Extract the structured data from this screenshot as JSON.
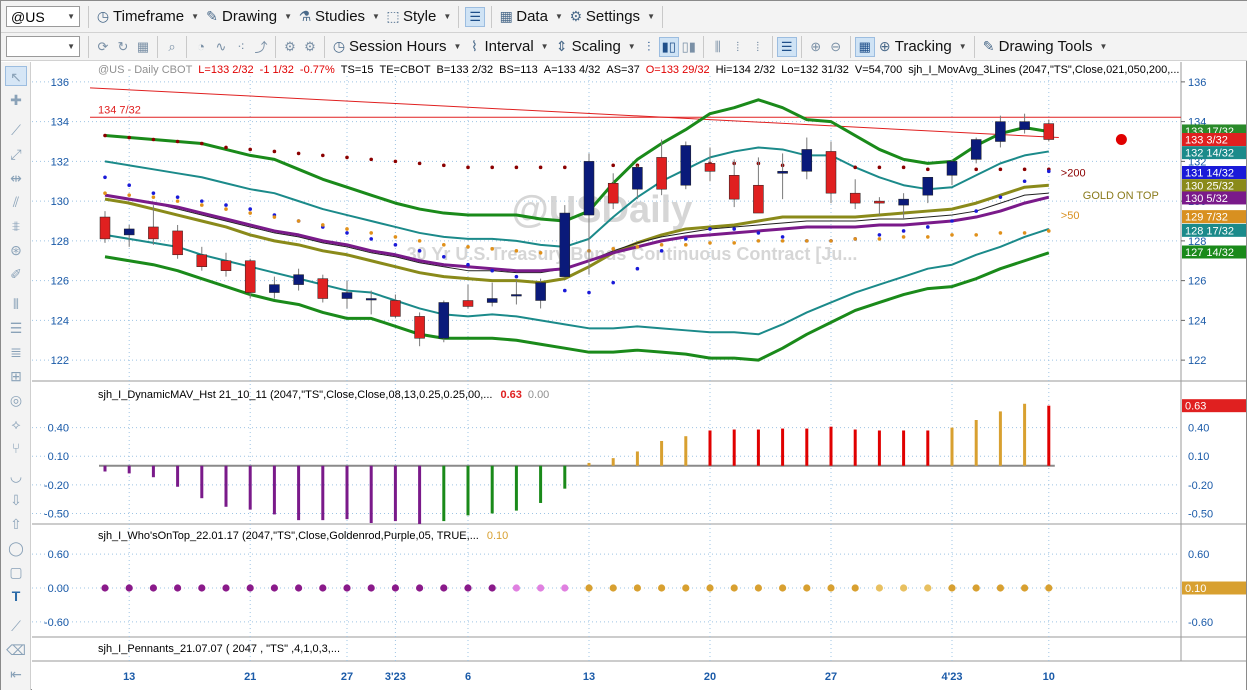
{
  "toolbar": {
    "symbol": "@US",
    "timeframe": "Timeframe",
    "drawing": "Drawing",
    "studies": "Studies",
    "style": "Style",
    "data": "Data",
    "settings": "Settings",
    "session_hours": "Session Hours",
    "interval": "Interval",
    "scaling": "Scaling",
    "tracking": "Tracking",
    "drawing_tools": "Drawing Tools"
  },
  "chart_data": {
    "type": "candlestick",
    "header": "@US - Daily  CBOT",
    "status": [
      {
        "text": "L=133 2/32",
        "color": "#e00000"
      },
      {
        "text": "-1 1/32",
        "color": "#e00000"
      },
      {
        "text": "-0.77%",
        "color": "#e00000"
      },
      {
        "text": "TS=15",
        "color": "#000000"
      },
      {
        "text": "TE=CBOT",
        "color": "#000000"
      },
      {
        "text": "B=133 2/32",
        "color": "#000000"
      },
      {
        "text": "BS=113",
        "color": "#000000"
      },
      {
        "text": "A=133 4/32",
        "color": "#000000"
      },
      {
        "text": "AS=37",
        "color": "#000000"
      },
      {
        "text": "O=133 29/32",
        "color": "#e00000"
      },
      {
        "text": "Hi=134 2/32",
        "color": "#000000"
      },
      {
        "text": "Lo=132 31/32",
        "color": "#000000"
      },
      {
        "text": "V=54,700",
        "color": "#000000"
      },
      {
        "text": "sjh_I_MovAvg_3Lines (2047,\"TS\",Close,021,050,200,...",
        "color": "#000000"
      }
    ],
    "watermark": "@USDaily",
    "watermark_sub": "30 Yr U.S.Treasury Bonds Continuous Contract [Ju...",
    "ylim": [
      121,
      137
    ],
    "yticks": [
      122,
      124,
      126,
      128,
      130,
      132,
      134,
      136
    ],
    "xlabels": [
      {
        "i": 1,
        "label": "13"
      },
      {
        "i": 6,
        "label": "21"
      },
      {
        "i": 10,
        "label": "27"
      },
      {
        "i": 12,
        "label": "3'23"
      },
      {
        "i": 15,
        "label": "6"
      },
      {
        "i": 20,
        "label": "13"
      },
      {
        "i": 25,
        "label": "20"
      },
      {
        "i": 30,
        "label": "27"
      },
      {
        "i": 35,
        "label": "4'23"
      },
      {
        "i": 39,
        "label": "10"
      }
    ],
    "candles": [
      {
        "o": 129.2,
        "h": 129.5,
        "l": 127.9,
        "c": 128.1
      },
      {
        "o": 128.3,
        "h": 128.8,
        "l": 127.7,
        "c": 128.6
      },
      {
        "o": 128.7,
        "h": 129.8,
        "l": 127.8,
        "c": 128.1
      },
      {
        "o": 128.5,
        "h": 128.8,
        "l": 127.1,
        "c": 127.3
      },
      {
        "o": 127.3,
        "h": 127.7,
        "l": 126.5,
        "c": 126.7
      },
      {
        "o": 127.0,
        "h": 127.4,
        "l": 126.2,
        "c": 126.5
      },
      {
        "o": 127.0,
        "h": 127.1,
        "l": 125.1,
        "c": 125.4
      },
      {
        "o": 125.4,
        "h": 126.2,
        "l": 125.1,
        "c": 125.8
      },
      {
        "o": 125.8,
        "h": 126.6,
        "l": 125.5,
        "c": 126.3
      },
      {
        "o": 126.1,
        "h": 126.3,
        "l": 124.9,
        "c": 125.1
      },
      {
        "o": 125.1,
        "h": 126.0,
        "l": 124.6,
        "c": 125.4
      },
      {
        "o": 125.1,
        "h": 125.5,
        "l": 124.3,
        "c": 125.1
      },
      {
        "o": 125.0,
        "h": 125.3,
        "l": 124.1,
        "c": 124.2
      },
      {
        "o": 124.2,
        "h": 124.4,
        "l": 122.7,
        "c": 123.1
      },
      {
        "o": 123.1,
        "h": 125.0,
        "l": 122.9,
        "c": 124.9
      },
      {
        "o": 125.0,
        "h": 125.8,
        "l": 124.6,
        "c": 124.7
      },
      {
        "o": 124.9,
        "h": 125.9,
        "l": 124.7,
        "c": 125.1
      },
      {
        "o": 125.3,
        "h": 126.0,
        "l": 124.8,
        "c": 125.3
      },
      {
        "o": 125.0,
        "h": 126.1,
        "l": 124.6,
        "c": 125.9
      },
      {
        "o": 126.2,
        "h": 129.8,
        "l": 126.1,
        "c": 129.4
      },
      {
        "o": 129.3,
        "h": 132.4,
        "l": 126.3,
        "c": 132.0
      },
      {
        "o": 130.9,
        "h": 131.4,
        "l": 129.6,
        "c": 129.9
      },
      {
        "o": 130.6,
        "h": 131.8,
        "l": 130.1,
        "c": 131.7
      },
      {
        "o": 132.2,
        "h": 133.1,
        "l": 130.3,
        "c": 130.6
      },
      {
        "o": 130.8,
        "h": 133.0,
        "l": 130.6,
        "c": 132.8
      },
      {
        "o": 131.9,
        "h": 132.7,
        "l": 131.0,
        "c": 131.5
      },
      {
        "o": 131.3,
        "h": 132.1,
        "l": 129.7,
        "c": 130.1
      },
      {
        "o": 130.8,
        "h": 132.2,
        "l": 129.6,
        "c": 129.4
      },
      {
        "o": 131.4,
        "h": 132.4,
        "l": 130.1,
        "c": 131.5
      },
      {
        "o": 131.5,
        "h": 133.2,
        "l": 131.1,
        "c": 132.6
      },
      {
        "o": 132.5,
        "h": 133.0,
        "l": 129.9,
        "c": 130.4
      },
      {
        "o": 130.4,
        "h": 131.1,
        "l": 129.6,
        "c": 129.9
      },
      {
        "o": 130.0,
        "h": 130.2,
        "l": 129.3,
        "c": 129.9
      },
      {
        "o": 129.8,
        "h": 130.4,
        "l": 129.1,
        "c": 130.1
      },
      {
        "o": 130.3,
        "h": 131.2,
        "l": 129.9,
        "c": 131.2
      },
      {
        "o": 131.3,
        "h": 132.1,
        "l": 130.8,
        "c": 132.0
      },
      {
        "o": 132.1,
        "h": 133.2,
        "l": 131.9,
        "c": 133.1
      },
      {
        "o": 133.0,
        "h": 134.3,
        "l": 132.7,
        "c": 134.0
      },
      {
        "o": 133.6,
        "h": 134.4,
        "l": 133.4,
        "c": 134.0
      },
      {
        "o": 133.9,
        "h": 134.1,
        "l": 133.0,
        "c": 133.1
      }
    ],
    "bands": [
      {
        "name": "outer-green",
        "color": "#1a8a1a",
        "width": 3,
        "upper": [
          133.3,
          133.2,
          133.1,
          133.0,
          132.9,
          132.6,
          132.3,
          132.1,
          131.6,
          131.1,
          130.7,
          130.3,
          129.9,
          129.6,
          129.4,
          129.3,
          129.3,
          129.3,
          129.1,
          129.0,
          129.5,
          130.9,
          132.1,
          132.9,
          133.6,
          134.4,
          134.7,
          135.1,
          134.7,
          134.1,
          134.0,
          133.3,
          132.6,
          132.1,
          131.9,
          132.0,
          132.8,
          133.4,
          133.7,
          133.5
        ],
        "lower": [
          127.2,
          127.0,
          126.8,
          126.5,
          126.1,
          125.7,
          125.3,
          125.0,
          124.8,
          124.4,
          124.1,
          124.1,
          123.7,
          123.3,
          123.1,
          123.1,
          123.1,
          123.0,
          122.8,
          122.6,
          122.4,
          122.4,
          122.5,
          122.4,
          122.3,
          122.1,
          122.1,
          122.0,
          122.6,
          123.3,
          123.9,
          124.5,
          124.9,
          125.3,
          125.6,
          125.7,
          126.1,
          126.6,
          127.0,
          127.4
        ]
      },
      {
        "name": "inner-teal",
        "color": "#1b8a8a",
        "width": 2,
        "upper": [
          132.0,
          131.8,
          131.6,
          131.4,
          131.2,
          130.9,
          130.6,
          130.4,
          130.0,
          129.6,
          129.3,
          129.0,
          128.7,
          128.4,
          128.2,
          128.1,
          128.1,
          128.0,
          127.8,
          127.7,
          128.1,
          129.2,
          130.2,
          131.0,
          131.6,
          132.2,
          132.5,
          132.7,
          132.6,
          132.3,
          132.3,
          131.7,
          131.2,
          130.8,
          130.6,
          130.7,
          131.3,
          131.9,
          132.3,
          132.5
        ],
        "lower": [
          128.3,
          128.1,
          127.9,
          127.7,
          127.3,
          127.0,
          126.7,
          126.4,
          126.1,
          125.8,
          125.5,
          125.4,
          125.0,
          124.6,
          124.3,
          124.2,
          124.3,
          124.2,
          124.0,
          123.8,
          123.6,
          123.6,
          123.7,
          123.6,
          123.5,
          123.4,
          123.4,
          123.3,
          123.8,
          124.4,
          124.9,
          125.4,
          125.8,
          126.2,
          126.6,
          126.8,
          127.3,
          127.7,
          128.2,
          128.6
        ]
      }
    ],
    "ma_lines": [
      {
        "name": "ma-gold",
        "color": "#8a8a1a",
        "width": 3,
        "values": [
          130.1,
          129.9,
          129.6,
          129.3,
          129.0,
          128.7,
          128.3,
          128.0,
          127.8,
          127.5,
          127.3,
          127.0,
          126.7,
          126.4,
          126.2,
          126.1,
          126.0,
          126.0,
          125.9,
          126.1,
          126.7,
          127.4,
          127.9,
          128.3,
          128.6,
          128.7,
          128.8,
          129.0,
          129.2,
          129.2,
          129.2,
          129.2,
          129.3,
          129.4,
          129.5,
          129.6,
          129.9,
          130.3,
          130.7,
          130.8
        ]
      },
      {
        "name": "ma-black",
        "color": "#202020",
        "width": 1,
        "values": [
          130.3,
          130.1,
          129.9,
          129.6,
          129.3,
          129.0,
          128.7,
          128.4,
          128.2,
          127.9,
          127.7,
          127.4,
          127.2,
          126.9,
          126.7,
          126.5,
          126.5,
          126.4,
          126.4,
          126.6,
          127.0,
          127.5,
          127.9,
          128.2,
          128.4,
          128.6,
          128.7,
          128.8,
          128.9,
          129.0,
          129.0,
          129.0,
          129.1,
          129.1,
          129.2,
          129.3,
          129.5,
          129.9,
          130.3,
          130.4
        ]
      },
      {
        "name": "ma-purple",
        "color": "#7a1a8a",
        "width": 3,
        "values": [
          130.3,
          130.1,
          129.9,
          129.7,
          129.4,
          129.1,
          128.8,
          128.5,
          128.3,
          128.0,
          127.8,
          127.5,
          127.3,
          127.0,
          126.8,
          126.7,
          126.6,
          126.5,
          126.5,
          126.6,
          127.0,
          127.4,
          127.7,
          128.0,
          128.2,
          128.3,
          128.4,
          128.5,
          128.6,
          128.7,
          128.7,
          128.7,
          128.8,
          128.8,
          128.9,
          129.0,
          129.2,
          129.5,
          129.9,
          130.2
        ]
      }
    ],
    "dot_series": [
      {
        "name": "dots-darkred",
        "color": "#8b0000",
        "values": [
          133.3,
          133.2,
          133.1,
          133.0,
          132.9,
          132.7,
          132.6,
          132.5,
          132.4,
          132.3,
          132.2,
          132.1,
          132.0,
          131.9,
          131.8,
          131.7,
          131.7,
          131.7,
          131.7,
          131.7,
          131.8,
          131.8,
          131.8,
          131.9,
          131.9,
          131.9,
          131.9,
          131.9,
          131.8,
          131.8,
          131.8,
          131.7,
          131.7,
          131.7,
          131.6,
          131.6,
          131.6,
          131.6,
          131.6,
          131.6
        ]
      },
      {
        "name": "dots-blue",
        "color": "#1a1ad8",
        "values": [
          131.2,
          130.8,
          130.4,
          130.2,
          130.0,
          129.8,
          129.6,
          129.3,
          129.0,
          128.7,
          128.4,
          128.1,
          127.8,
          127.5,
          127.2,
          126.8,
          126.5,
          126.2,
          125.8,
          125.5,
          125.4,
          125.9,
          126.6,
          127.5,
          128.1,
          128.6,
          128.6,
          128.4,
          128.2,
          128.0,
          128.0,
          128.1,
          128.3,
          128.5,
          128.7,
          129.0,
          129.5,
          130.2,
          131.0,
          131.5
        ]
      },
      {
        "name": "dots-orange",
        "color": "#e0901a",
        "values": [
          130.4,
          130.3,
          130.2,
          130.0,
          129.8,
          129.6,
          129.4,
          129.2,
          129.0,
          128.8,
          128.6,
          128.4,
          128.2,
          128.0,
          127.8,
          127.7,
          127.6,
          127.5,
          127.4,
          127.4,
          127.5,
          127.6,
          127.7,
          127.8,
          127.8,
          127.9,
          127.9,
          128.0,
          128.0,
          128.0,
          128.0,
          128.1,
          128.1,
          128.2,
          128.2,
          128.3,
          128.3,
          128.4,
          128.4,
          128.5
        ]
      }
    ],
    "trendline": {
      "color": "#e02020",
      "y_start": 135.7,
      "y_end": 133.2
    },
    "hline": {
      "value": 134.22,
      "label": "134 7/32",
      "color": "#e02020"
    },
    "event_marker": {
      "i": 42,
      "value": 133.1,
      "color": "#e00000"
    },
    "price_labels": [
      {
        "value": 133.53,
        "text": "133 17/32",
        "color": "#2a8a2a"
      },
      {
        "value": 133.1,
        "text": "133 3/32",
        "color": "#e02020"
      },
      {
        "value": 132.44,
        "text": "132 14/32",
        "color": "#1b8a8a"
      },
      {
        "value": 131.44,
        "text": "131 14/32",
        "color": "#1a1ad8"
      },
      {
        "value": 130.78,
        "text": "130 25/32",
        "color": "#8a8a1a"
      },
      {
        "value": 130.16,
        "text": "130 5/32",
        "color": "#7a1a8a"
      },
      {
        "value": 129.22,
        "text": "129 7/32",
        "color": "#d89020"
      },
      {
        "value": 128.53,
        "text": "128 17/32",
        "color": "#1b8a8a"
      },
      {
        "value": 127.44,
        "text": "127 14/32",
        "color": "#1a8a1a"
      }
    ],
    "annotations": [
      {
        "text": ">200",
        "color": "#8b0000",
        "value": 131.45,
        "offset": 0
      },
      {
        "text": "GOLD ON TOP",
        "color": "#8a7a1a",
        "value": 130.3,
        "offset": 22
      },
      {
        "text": ">50",
        "color": "#d89020",
        "value": 129.3,
        "offset": 0
      }
    ],
    "dynamic_mav": {
      "title": "sjh_I_DynamicMAV_Hst 21_10_11 (2047,\"TS\",Close,Close,08,13,0.25,0.25,00,...",
      "current": "0.63",
      "current2": "0.00",
      "yticks": [
        0.4,
        0.1,
        -0.2,
        -0.5
      ],
      "ytick_labels": [
        "0.40",
        "0.10",
        "-0.20",
        "-0.50"
      ],
      "ylim": [
        -0.6,
        0.7
      ],
      "values": [
        -0.06,
        -0.08,
        -0.12,
        -0.22,
        -0.34,
        -0.43,
        -0.46,
        -0.51,
        -0.57,
        -0.57,
        -0.56,
        -0.6,
        -0.58,
        -0.61,
        -0.58,
        -0.52,
        -0.5,
        -0.47,
        -0.39,
        -0.24,
        0.03,
        0.08,
        0.15,
        0.26,
        0.31,
        0.37,
        0.38,
        0.38,
        0.39,
        0.39,
        0.41,
        0.38,
        0.37,
        0.37,
        0.37,
        0.4,
        0.48,
        0.57,
        0.65,
        0.63
      ],
      "colors": [
        "#7a1a8a",
        "#7a1a8a",
        "#7a1a8a",
        "#7a1a8a",
        "#7a1a8a",
        "#7a1a8a",
        "#7a1a8a",
        "#7a1a8a",
        "#7a1a8a",
        "#7a1a8a",
        "#7a1a8a",
        "#7a1a8a",
        "#7a1a8a",
        "#7a1a8a",
        "#1a8a1a",
        "#1a8a1a",
        "#1a8a1a",
        "#1a8a1a",
        "#1a8a1a",
        "#1a8a1a",
        "#d8a030",
        "#d8a030",
        "#d8a030",
        "#d8a030",
        "#d8a030",
        "#e00000",
        "#e00000",
        "#e00000",
        "#e00000",
        "#e00000",
        "#e00000",
        "#e00000",
        "#e00000",
        "#e00000",
        "#e00000",
        "#d8a030",
        "#d8a030",
        "#d8a030",
        "#d8a030",
        "#e00000"
      ],
      "label_color": "#e02020"
    },
    "whos_on_top": {
      "title": "sjh_I_Who'sOnTop_22.01.17 (2047,\"TS\",Close,Goldenrod,Purple,05, TRUE,...",
      "current": "0.10",
      "yticks": [
        0.6,
        0.0,
        -0.6
      ],
      "ytick_labels": [
        "0.60",
        "0.00",
        "-0.60"
      ],
      "ylim": [
        -0.85,
        0.85
      ],
      "value": 0.0,
      "colors": [
        "#8a1a8a",
        "#8a1a8a",
        "#8a1a8a",
        "#8a1a8a",
        "#8a1a8a",
        "#8a1a8a",
        "#8a1a8a",
        "#8a1a8a",
        "#8a1a8a",
        "#8a1a8a",
        "#8a1a8a",
        "#8a1a8a",
        "#8a1a8a",
        "#8a1a8a",
        "#8a1a8a",
        "#8a1a8a",
        "#8a1a8a",
        "#e080e0",
        "#e080e0",
        "#e080e0",
        "#d8a030",
        "#d8a030",
        "#d8a030",
        "#d8a030",
        "#d8a030",
        "#d8a030",
        "#d8a030",
        "#d8a030",
        "#d8a030",
        "#d8a030",
        "#d8a030",
        "#d8a030",
        "#e8c060",
        "#e8c060",
        "#e8c060",
        "#d8a030",
        "#d8a030",
        "#d8a030",
        "#d8a030",
        "#d8a030"
      ],
      "label_color": "#d8a030"
    },
    "pennants": {
      "title": "sjh_I_Pennants_21.07.07 ( 2047 , \"TS\" ,4,1,0,3,..."
    }
  }
}
